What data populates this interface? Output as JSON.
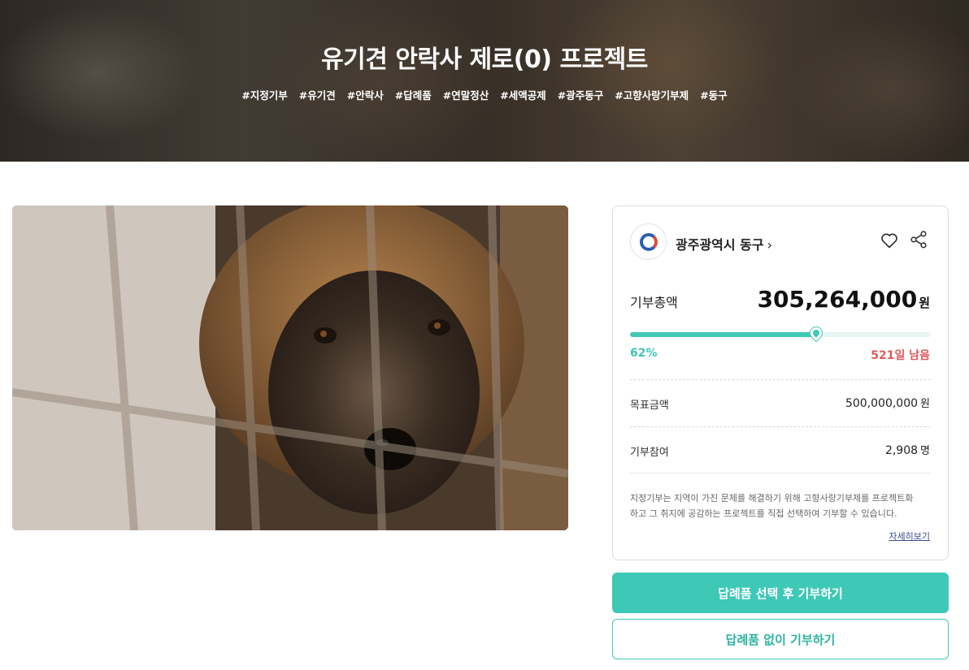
{
  "hero": {
    "title": "유기견 안락사 제로(0) 프로젝트",
    "tags": [
      "#지정기부",
      "#유기견",
      "#안락사",
      "#답례품",
      "#연말정산",
      "#세액공제",
      "#광주동구",
      "#고향사랑기부제",
      "#동구"
    ]
  },
  "photo": {
    "subject": "dog-behind-cage"
  },
  "card": {
    "org_name": "광주광역시 동구",
    "org_chevron": "›",
    "total_label": "기부총액",
    "total_value": "305,264,000",
    "total_unit": "원",
    "progress": {
      "percent_label": "62%",
      "percent": 62,
      "remaining": "521일 남음"
    },
    "goal_label": "목표금액",
    "goal_value": "500,000,000",
    "goal_unit": "원",
    "participants_label": "기부참여",
    "participants_value": "2,908",
    "participants_unit": "명",
    "info_line1": "지정기부는 지역이 가진 문제를 해결하기 위해 고향사랑기부제를 프로젝트화",
    "info_line2": "하고 그 취지에 공감하는 프로젝트를 직접 선택하여 기부할 수 있습니다.",
    "more_link": "자세히보기"
  },
  "buttons": {
    "primary": "답례품 선택 후 기부하기",
    "secondary": "답례품 없이 기부하기"
  },
  "colors": {
    "accent": "#3ec8b6",
    "remaining": "#e05a5a",
    "link": "#3a4c8c"
  },
  "icons": {
    "favorite": "heart-icon",
    "share": "share-icon",
    "org": "org-logo"
  }
}
